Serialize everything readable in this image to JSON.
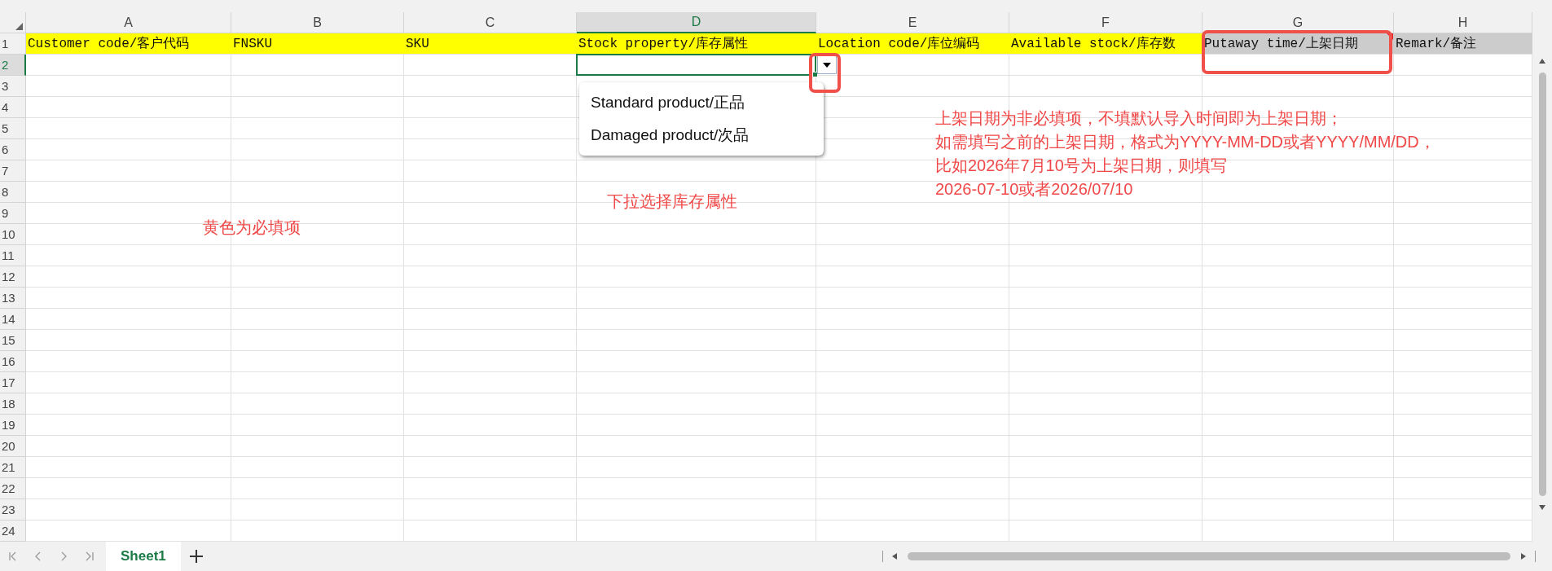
{
  "columns": [
    {
      "label": "A",
      "selected": false
    },
    {
      "label": "B",
      "selected": false
    },
    {
      "label": "C",
      "selected": false
    },
    {
      "label": "D",
      "selected": true
    },
    {
      "label": "E",
      "selected": false
    },
    {
      "label": "F",
      "selected": false
    },
    {
      "label": "G",
      "selected": false
    },
    {
      "label": "H",
      "selected": false
    }
  ],
  "rows": [
    {
      "label": "1",
      "selected": false
    },
    {
      "label": "2",
      "selected": true
    },
    {
      "label": "3",
      "selected": false
    },
    {
      "label": "4",
      "selected": false
    },
    {
      "label": "5",
      "selected": false
    },
    {
      "label": "6",
      "selected": false
    },
    {
      "label": "7",
      "selected": false
    },
    {
      "label": "8",
      "selected": false
    },
    {
      "label": "9",
      "selected": false
    },
    {
      "label": "10",
      "selected": false
    },
    {
      "label": "11",
      "selected": false
    },
    {
      "label": "12",
      "selected": false
    },
    {
      "label": "13",
      "selected": false
    },
    {
      "label": "14",
      "selected": false
    },
    {
      "label": "15",
      "selected": false
    },
    {
      "label": "16",
      "selected": false
    },
    {
      "label": "17",
      "selected": false
    },
    {
      "label": "18",
      "selected": false
    },
    {
      "label": "19",
      "selected": false
    },
    {
      "label": "20",
      "selected": false
    },
    {
      "label": "21",
      "selected": false
    },
    {
      "label": "22",
      "selected": false
    },
    {
      "label": "23",
      "selected": false
    },
    {
      "label": "24",
      "selected": false
    }
  ],
  "header_cells": [
    {
      "text": "Customer code/客户代码",
      "required": true,
      "comment": false
    },
    {
      "text": "FNSKU",
      "required": true,
      "comment": false
    },
    {
      "text": "SKU",
      "required": true,
      "comment": false
    },
    {
      "text": "Stock property/库存属性",
      "required": true,
      "comment": false
    },
    {
      "text": "Location code/库位编码",
      "required": true,
      "comment": false
    },
    {
      "text": "Available stock/库存数",
      "required": true,
      "comment": false
    },
    {
      "text": "Putaway time/上架日期",
      "required": false,
      "comment": true
    },
    {
      "text": "Remark/备注",
      "required": false,
      "comment": false
    }
  ],
  "dropdown": {
    "options": [
      "Standard product/正品",
      "Damaged product/次品"
    ]
  },
  "annotations": [
    {
      "kind": "required",
      "lines": [
        "黄色为必填项"
      ]
    },
    {
      "kind": "dropdown",
      "lines": [
        "下拉选择库存属性"
      ]
    },
    {
      "kind": "date",
      "lines": [
        "上架日期为非必填项，不填默认导入时间即为上架日期；",
        "如需填写之前的上架日期，格式为YYYY-MM-DD或者YYYY/MM/DD，",
        "比如2026年7月10号为上架日期，则填写",
        "2026-07-10或者2026/07/10"
      ]
    }
  ],
  "sheet_tabs": [
    {
      "label": "Sheet1",
      "selected": true
    }
  ]
}
